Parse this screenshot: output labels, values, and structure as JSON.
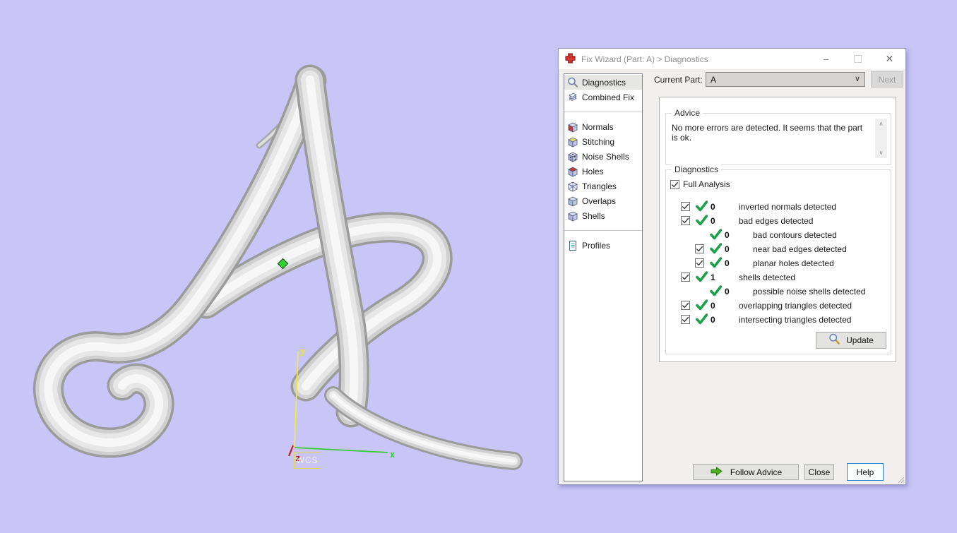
{
  "window": {
    "title": "Fix Wizard (Part: A) > Diagnostics",
    "icon": "red-cross-icon",
    "minimize_glyph": "–",
    "close_glyph": "✕"
  },
  "header": {
    "current_part_label": "Current Part:",
    "current_part_value": "A",
    "next_button": "Next"
  },
  "sidebar": {
    "groups": [
      [
        {
          "label": "Diagnostics",
          "icon": "magnifier-icon",
          "selected": true
        },
        {
          "label": "Combined Fix",
          "icon": "layers-icon",
          "selected": false
        }
      ],
      [
        {
          "label": "Normals",
          "icon": "cube-normals-icon",
          "selected": false
        },
        {
          "label": "Stitching",
          "icon": "cube-stitching-icon",
          "selected": false
        },
        {
          "label": "Noise Shells",
          "icon": "cube-noise-icon",
          "selected": false
        },
        {
          "label": "Holes",
          "icon": "cube-holes-icon",
          "selected": false
        },
        {
          "label": "Triangles",
          "icon": "cube-triangles-icon",
          "selected": false
        },
        {
          "label": "Overlaps",
          "icon": "cube-overlaps-icon",
          "selected": false
        },
        {
          "label": "Shells",
          "icon": "cube-shells-icon",
          "selected": false
        }
      ],
      [
        {
          "label": "Profiles",
          "icon": "document-icon",
          "selected": false
        }
      ]
    ]
  },
  "advice": {
    "group_label": "Advice",
    "text": "No more errors are detected. It seems that the part is ok."
  },
  "diagnostics": {
    "group_label": "Diagnostics",
    "full_analysis_label": "Full Analysis",
    "full_analysis_checked": true,
    "rows": [
      {
        "checkbox": true,
        "count": "0",
        "label": "inverted normals detected",
        "indent": 0
      },
      {
        "checkbox": true,
        "count": "0",
        "label": "bad edges detected",
        "indent": 0
      },
      {
        "checkbox": false,
        "count": "0",
        "label": "bad contours detected",
        "indent": 1
      },
      {
        "checkbox": true,
        "count": "0",
        "label": "near bad edges detected",
        "indent": 1
      },
      {
        "checkbox": true,
        "count": "0",
        "label": "planar holes detected",
        "indent": 1
      },
      {
        "checkbox": true,
        "count": "1",
        "label": "shells detected",
        "indent": 0
      },
      {
        "checkbox": false,
        "count": "0",
        "label": "possible noise shells detected",
        "indent": 1
      },
      {
        "checkbox": true,
        "count": "0",
        "label": "overlapping triangles detected",
        "indent": 0
      },
      {
        "checkbox": true,
        "count": "0",
        "label": "intersecting triangles detected",
        "indent": 0
      }
    ],
    "update_button": "Update"
  },
  "footer": {
    "follow_advice_button": "Follow Advice",
    "close_button": "Close",
    "help_button": "Help"
  },
  "viewport": {
    "part_shown": "A",
    "wcs_label": "WCS",
    "axes": {
      "x": "x",
      "y": "y",
      "z": "z"
    },
    "colors": {
      "background": "#c9c6f7",
      "axis_x": "#35cc35",
      "axis_y": "#f0ee2e",
      "axis_z": "#c02020",
      "vertex_marker": "#2fd42f",
      "check_green": "#1da04a"
    }
  }
}
